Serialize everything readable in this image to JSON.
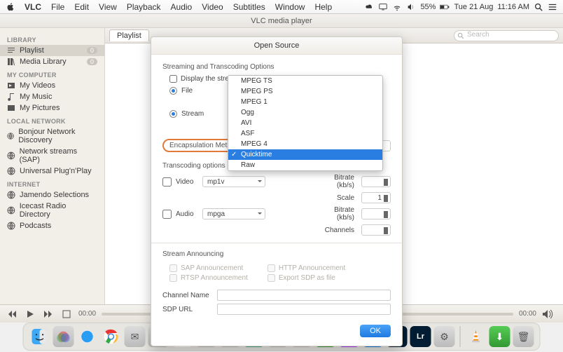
{
  "menubar": {
    "app": "VLC",
    "items": [
      "File",
      "Edit",
      "View",
      "Playback",
      "Audio",
      "Video",
      "Subtitles",
      "Window",
      "Help"
    ],
    "battery": "55%",
    "date": "Tue 21 Aug",
    "time": "11:16 AM"
  },
  "window": {
    "title": "VLC media player"
  },
  "sidebar": {
    "sections": [
      {
        "title": "LIBRARY",
        "items": [
          {
            "label": "Playlist",
            "icon": "playlist",
            "selected": true,
            "badge": "0"
          },
          {
            "label": "Media Library",
            "icon": "library",
            "badge": "0"
          }
        ]
      },
      {
        "title": "MY COMPUTER",
        "items": [
          {
            "label": "My Videos",
            "icon": "video"
          },
          {
            "label": "My Music",
            "icon": "music"
          },
          {
            "label": "My Pictures",
            "icon": "picture"
          }
        ]
      },
      {
        "title": "LOCAL NETWORK",
        "items": [
          {
            "label": "Bonjour Network Discovery",
            "icon": "globe"
          },
          {
            "label": "Network streams (SAP)",
            "icon": "globe"
          },
          {
            "label": "Universal Plug'n'Play",
            "icon": "globe"
          }
        ]
      },
      {
        "title": "INTERNET",
        "items": [
          {
            "label": "Jamendo Selections",
            "icon": "globe"
          },
          {
            "label": "Icecast Radio Directory",
            "icon": "globe"
          },
          {
            "label": "Podcasts",
            "icon": "globe"
          }
        ]
      }
    ]
  },
  "tab": {
    "label": "Playlist"
  },
  "search": {
    "placeholder": "Search"
  },
  "dialog": {
    "title": "Open Source",
    "section_stream": "Streaming and Transcoding Options",
    "display_locally": "Display the stream locally",
    "file_label": "File",
    "stream_label": "Stream",
    "enc_label": "Encapsulation Method",
    "section_transcode": "Transcoding options",
    "video_label": "Video",
    "video_codec": "mp1v",
    "audio_label": "Audio",
    "audio_codec": "mpga",
    "bitrate_label": "Bitrate (kb/s)",
    "scale_label": "Scale",
    "scale_value": "1",
    "channels_label": "Channels",
    "section_announce": "Stream Announcing",
    "sap": "SAP Announcement",
    "rtsp": "RTSP Announcement",
    "http": "HTTP Announcement",
    "sdp": "Export SDP as file",
    "channel_name": "Channel Name",
    "sdp_url": "SDP URL",
    "ok": "OK"
  },
  "dropdown": {
    "options": [
      "MPEG TS",
      "MPEG PS",
      "MPEG 1",
      "Ogg",
      "AVI",
      "ASF",
      "MPEG 4",
      "Quicktime",
      "Raw"
    ],
    "selected": "Quicktime"
  },
  "player": {
    "elapsed": "00:00",
    "remaining": "00:00"
  }
}
